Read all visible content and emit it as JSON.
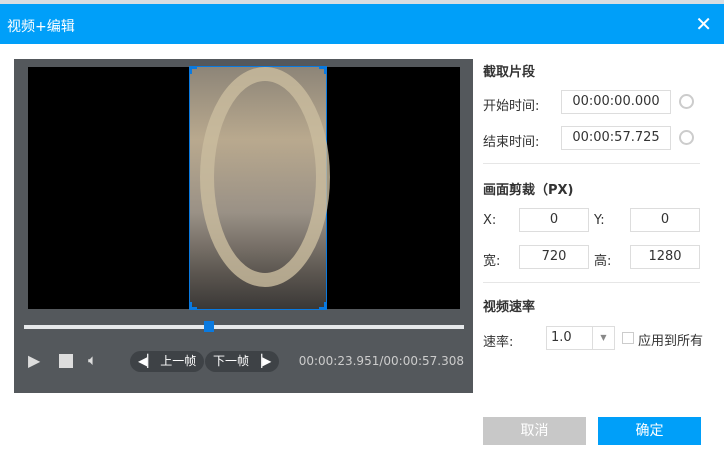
{
  "dialog": {
    "title": "视频+编辑",
    "close_icon": "close-icon"
  },
  "player": {
    "prev_frame": "上一帧",
    "next_frame": "下一帧",
    "time": "00:00:23.951/00:00:57.308",
    "progress": 0.42
  },
  "clip": {
    "heading": "截取片段",
    "start_label": "开始时间:",
    "start_value": "00:00:00.000",
    "end_label": "结束时间:",
    "end_value": "00:00:57.725"
  },
  "crop": {
    "heading": "画面剪裁（PX)",
    "x_label": "X:",
    "x_value": "0",
    "y_label": "Y:",
    "y_value": "0",
    "w_label": "宽:",
    "w_value": "720",
    "h_label": "高:",
    "h_value": "1280"
  },
  "speed": {
    "heading": "视频速率",
    "label": "速率:",
    "value": "1.0",
    "apply_all": "应用到所有"
  },
  "footer": {
    "cancel": "取消",
    "ok": "确定"
  },
  "colors": {
    "accent": "#009ff9",
    "panel": "#54585c"
  }
}
